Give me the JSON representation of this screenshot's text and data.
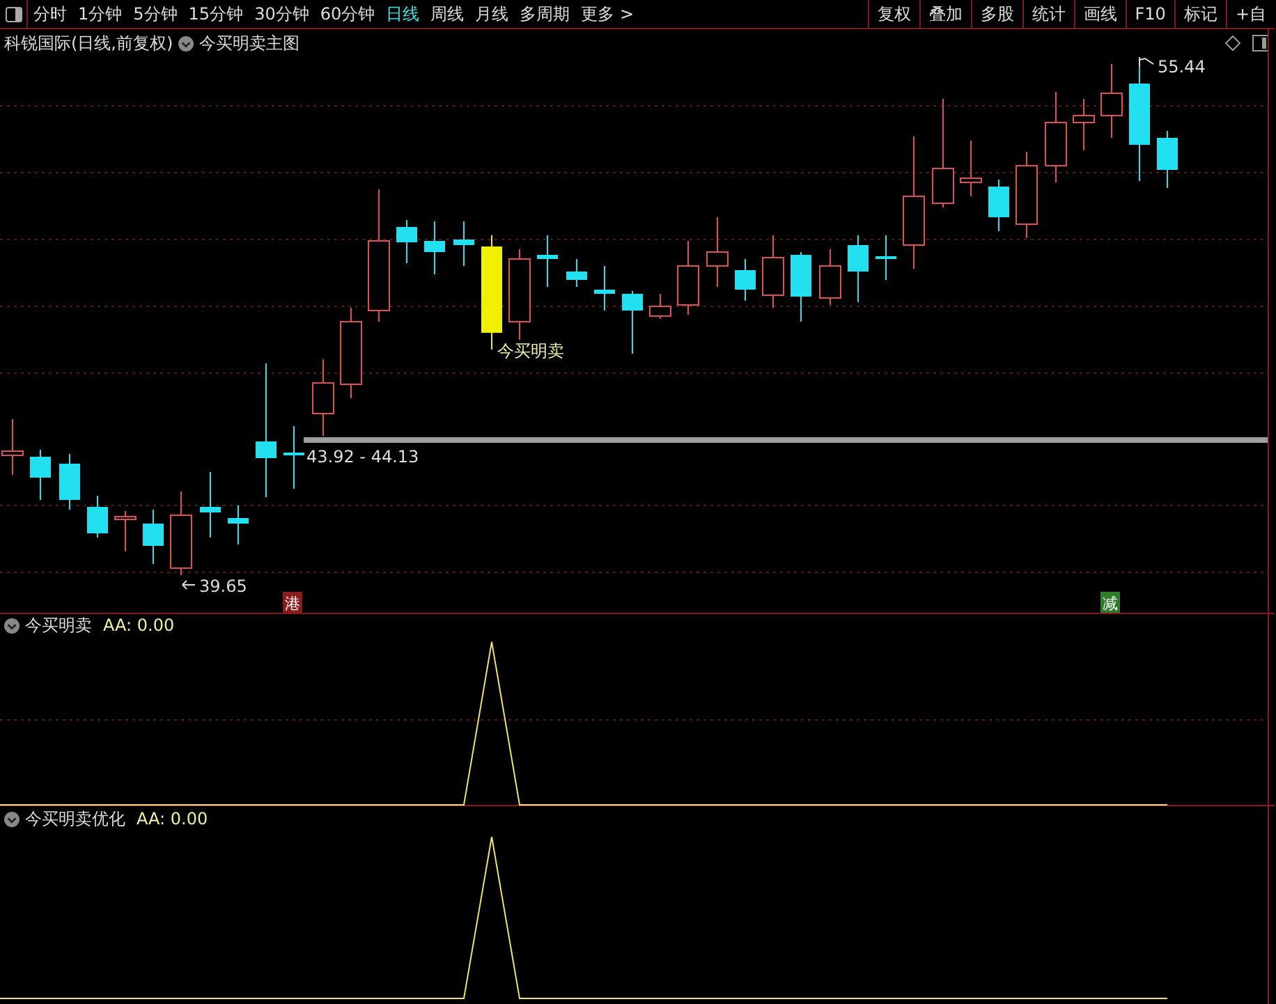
{
  "toolbar": {
    "tabs": [
      {
        "label": "分时",
        "selected": false
      },
      {
        "label": "1分钟",
        "selected": false
      },
      {
        "label": "5分钟",
        "selected": false
      },
      {
        "label": "15分钟",
        "selected": false
      },
      {
        "label": "30分钟",
        "selected": false
      },
      {
        "label": "60分钟",
        "selected": false
      },
      {
        "label": "日线",
        "selected": true
      },
      {
        "label": "周线",
        "selected": false
      },
      {
        "label": "月线",
        "selected": false
      },
      {
        "label": "多周期",
        "selected": false
      },
      {
        "label": "更多 >",
        "selected": false
      }
    ],
    "buttons": [
      "复权",
      "叠加",
      "多股",
      "统计",
      "画线",
      "F10",
      "标记",
      "+自"
    ]
  },
  "chart": {
    "title": "科锐国际(日线,前复权)",
    "indicator": "今买明卖主图",
    "signal_label": "今买明卖",
    "range_label": "43.92 - 44.13",
    "low_label": "39.65",
    "high_label": "55.44",
    "markers": [
      {
        "text": "港",
        "color": "#8c1c1c"
      },
      {
        "text": "减",
        "color": "#2f7d2a"
      }
    ]
  },
  "panes": [
    {
      "name": "今买明卖",
      "reading": "AA: 0.00"
    },
    {
      "name": "今买明卖优化",
      "reading": "AA: 0.00"
    }
  ]
}
